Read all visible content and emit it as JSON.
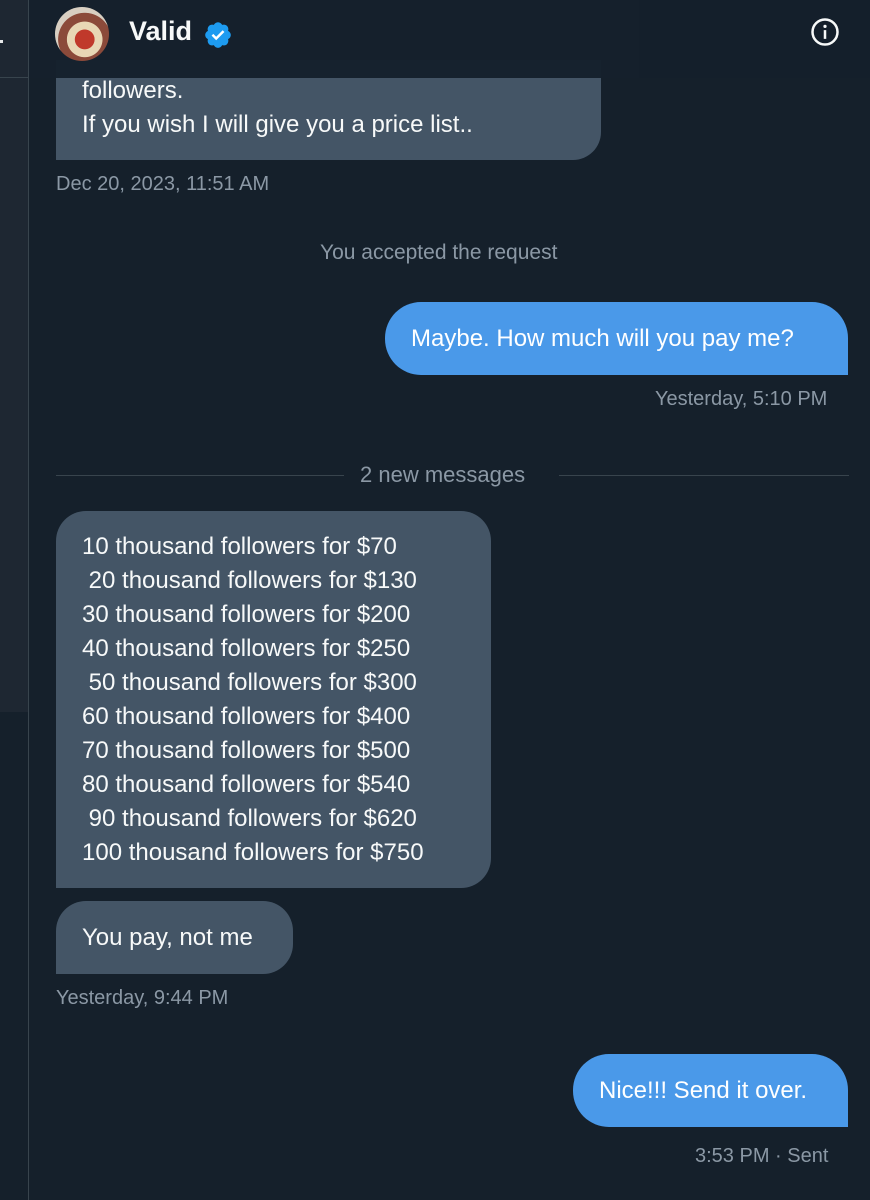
{
  "header": {
    "name": "Valid"
  },
  "messages": {
    "first_partial": [
      "followers.",
      "If you wish I will give you a price list.."
    ],
    "first_time": "Dec 20, 2023, 11:51 AM",
    "system_note": "You accepted the request",
    "out1": "Maybe. How much will you pay me?",
    "out1_time": "Yesterday, 5:10 PM",
    "new_divider": "2 new messages",
    "price_list": [
      "10 thousand followers for $70",
      " 20 thousand followers for $130",
      "30 thousand followers for $200",
      "40 thousand followers for $250",
      " 50 thousand followers for $300",
      "60 thousand followers for $400",
      "70 thousand followers for $500",
      "80 thousand followers for $540",
      " 90 thousand followers for $620",
      "100 thousand followers for $750"
    ],
    "in2": "You pay, not me",
    "in2_time": "Yesterday, 9:44 PM",
    "out2": "Nice!!! Send it over.",
    "out2_time": "3:53 PM · Sent"
  },
  "colors": {
    "background": "#15202b",
    "incoming_bubble": "#445566",
    "outgoing_bubble": "#4a99e9",
    "muted_text": "#8b98a5",
    "verified_badge": "#1d9bf0"
  },
  "icons": {
    "verified": "verified-badge-icon",
    "info": "info-icon"
  }
}
